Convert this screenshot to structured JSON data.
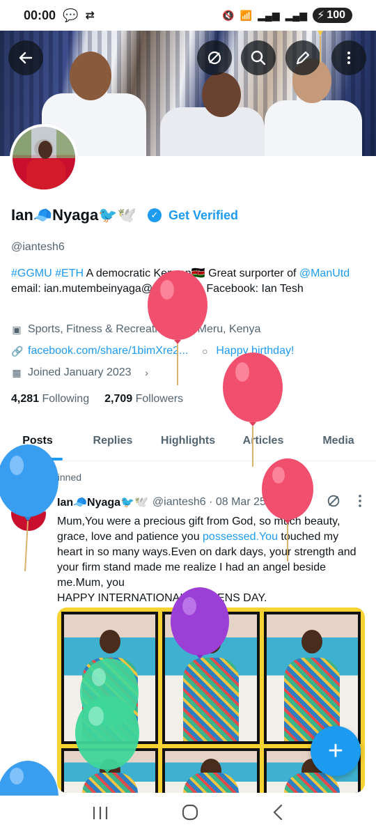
{
  "status": {
    "time": "00:00",
    "battery": "100"
  },
  "profile": {
    "name": "Ian🧢Nyaga🐦🕊️",
    "get_verified": "Get Verified",
    "handle": "@iantesh6",
    "bio": {
      "hashtags": "#GGMU #ETH",
      "part1": " A democratic Kenyan🇰🇪   Great surporter of ",
      "mention": "@ManUtd",
      "part2": " email: ian.mutembeinyaga@gmail.com Facebook: Ian Tesh"
    },
    "category": "Sports, Fitness & Recreation",
    "location": "Meru, Kenya",
    "website": "facebook.com/share/1bimXre2...",
    "birthday": "Happy birthday!",
    "joined": "Joined January 2023",
    "following_count": "4,281",
    "following_label": "Following",
    "followers_count": "2,709",
    "followers_label": "Followers"
  },
  "tabs": [
    "Posts",
    "Replies",
    "Highlights",
    "Articles",
    "Media"
  ],
  "post": {
    "pinned_label": "Pinned",
    "author": "Ian🧢Nyaga🐦🕊️",
    "handle_date": "@iantesh6 · 08 Mar 25",
    "text1": "Mum,You were a precious  gift from God, so much beauty, grace, love and patience you ",
    "link": "possessed.You",
    "text2": " touched my heart in so many ways.Even on dark days, your strength and your firm stand made me realize I had an angel beside me.Mum, you",
    "text3": "  HAPPY INTERNATIONAL WOMENS DAY."
  },
  "icons": {
    "back": "back-arrow-icon",
    "grok": "grok-icon",
    "search": "search-icon",
    "edit": "edit-icon",
    "more": "more-vertical-icon",
    "fab": "plus-icon"
  },
  "colors": {
    "accent": "#1d9bf0",
    "text": "#0f1419",
    "secondary": "#536471"
  }
}
